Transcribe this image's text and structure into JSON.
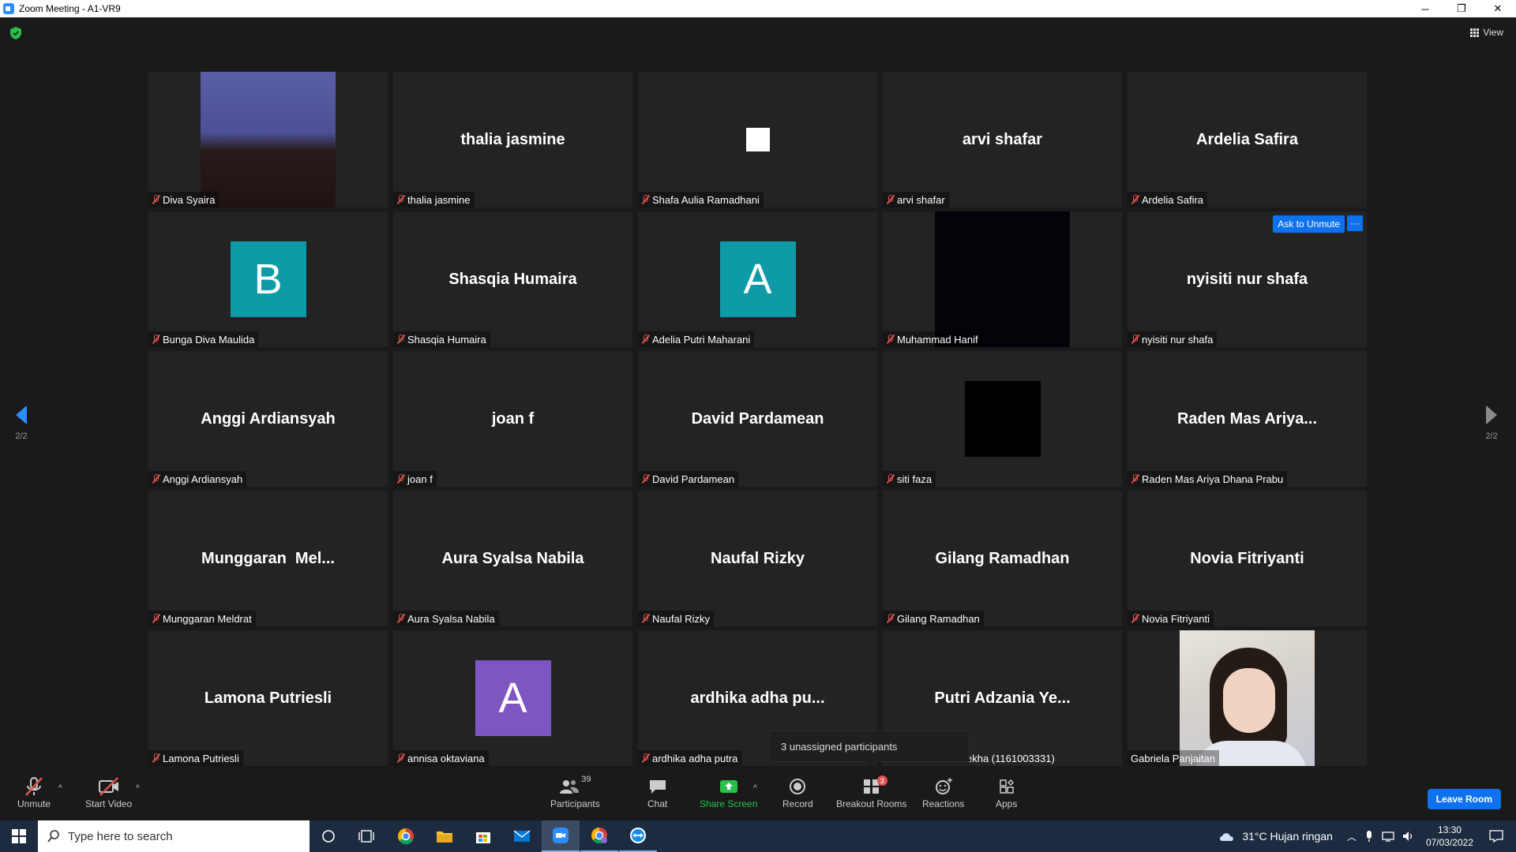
{
  "window": {
    "title": "Zoom Meeting - A1-VR9",
    "minimize": "─",
    "restore": "❐",
    "close": "✕"
  },
  "view": {
    "label": "View"
  },
  "pager": {
    "prev_page": "2/2",
    "next_page": "2/2"
  },
  "tiles": [
    {
      "display": "",
      "label": "Diva Syaira"
    },
    {
      "display": "thalia jasmine",
      "label": "thalia jasmine"
    },
    {
      "display": "",
      "label": "Shafa Aulia Ramadhani"
    },
    {
      "display": "arvi shafar",
      "label": "arvi shafar"
    },
    {
      "display": "Ardelia Safira",
      "label": "Ardelia Safira"
    },
    {
      "display": "B",
      "label": "Bunga Diva Maulida"
    },
    {
      "display": "Shasqia Humaira",
      "label": "Shasqia Humaira"
    },
    {
      "display": "A",
      "label": "Adelia Putri Maharani"
    },
    {
      "display": "",
      "label": "Muhammad Hanif"
    },
    {
      "display": "nyisiti nur shafa",
      "label": "nyisiti nur shafa"
    },
    {
      "display": "Anggi Ardiansyah",
      "label": "Anggi Ardiansyah"
    },
    {
      "display": "joan f",
      "label": "joan f"
    },
    {
      "display": "David Pardamean",
      "label": "David Pardamean"
    },
    {
      "display": "",
      "label": "siti faza"
    },
    {
      "display": "Raden Mas Ariya...",
      "label": "Raden Mas Ariya Dhana Prabu"
    },
    {
      "display": "Munggaran  Mel...",
      "label": "Munggaran Meldrat"
    },
    {
      "display": "Aura Syalsa Nabila",
      "label": "Aura Syalsa Nabila"
    },
    {
      "display": "Naufal Rizky",
      "label": "Naufal Rizky"
    },
    {
      "display": "Gilang Ramadhan",
      "label": "Gilang Ramadhan"
    },
    {
      "display": "Novia Fitriyanti",
      "label": "Novia Fitriyanti"
    },
    {
      "display": "Lamona Putriesli",
      "label": "Lamona Putriesli"
    },
    {
      "display": "A",
      "label": "annisa oktaviana"
    },
    {
      "display": "ardhika adha pu...",
      "label": "ardhika adha putra"
    },
    {
      "display": "Putri Adzania Ye...",
      "label": "ekha (1161003331)"
    },
    {
      "display": "",
      "label": "Gabriela Panjaitan"
    }
  ],
  "tile_actions": {
    "ask_to_unmute": "Ask to Unmute",
    "more": "···"
  },
  "colors": {
    "avatar_teal": "#0e9aa7",
    "avatar_purple": "#7e56c2",
    "accent": "#0e72ed",
    "muted_red": "#e0524e"
  },
  "tooltip": {
    "text": "3 unassigned participants"
  },
  "toolbar": {
    "unmute": "Unmute",
    "start_video": "Start Video",
    "participants": "Participants",
    "participants_count": "39",
    "chat": "Chat",
    "share_screen": "Share Screen",
    "record": "Record",
    "breakout_rooms": "Breakout Rooms",
    "breakout_badge": "3",
    "reactions": "Reactions",
    "apps": "Apps",
    "leave_room": "Leave Room",
    "caret": "^"
  },
  "taskbar": {
    "search_placeholder": "Type here to search",
    "weather": "31°C  Hujan ringan",
    "time": "13:30",
    "date": "07/03/2022",
    "icons": [
      "windows-start-icon",
      "cortana-icon",
      "task-view-icon",
      "chrome-icon",
      "file-explorer-icon",
      "store-icon",
      "mail-icon",
      "zoom-icon",
      "chrome-profile-icon",
      "teamviewer-icon"
    ]
  }
}
